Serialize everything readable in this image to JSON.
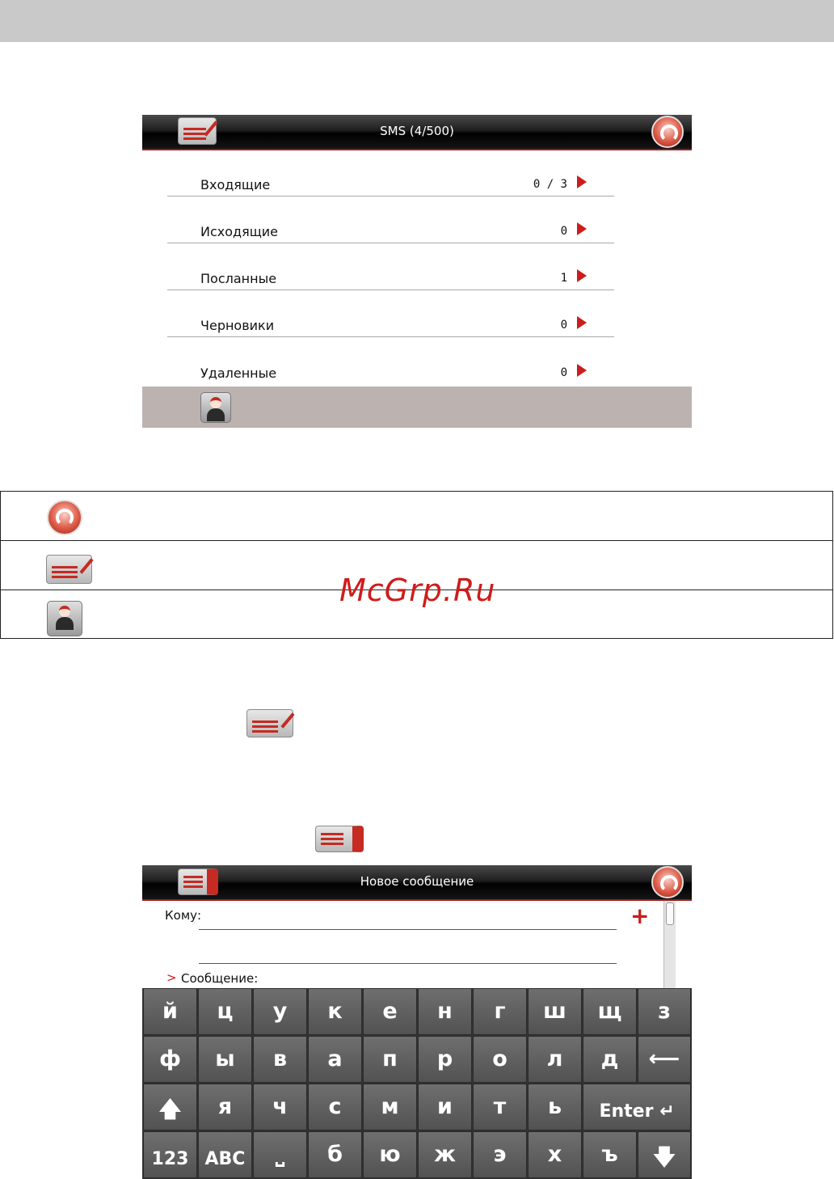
{
  "screen1": {
    "title": "SMS (4/500)",
    "folders": [
      {
        "label": "Входящие",
        "count": "0 / 3"
      },
      {
        "label": "Исходящие",
        "count": "0"
      },
      {
        "label": "Посланные",
        "count": "1"
      },
      {
        "label": "Черновики",
        "count": "0"
      },
      {
        "label": "Удаленные",
        "count": "0"
      }
    ]
  },
  "legend": {
    "icons": [
      "home-icon",
      "new-message-icon",
      "contacts-icon"
    ]
  },
  "watermark": "McGrp.Ru",
  "screen2": {
    "title": "Новое сообщение",
    "to_label": "Кому:",
    "add_symbol": "+",
    "message_label": "Сообщение:",
    "message_marker": ">",
    "keyboard": {
      "row1": [
        "й",
        "ц",
        "у",
        "к",
        "е",
        "н",
        "г",
        "ш",
        "щ",
        "з"
      ],
      "row2": [
        "ф",
        "ы",
        "в",
        "а",
        "п",
        "р",
        "о",
        "л",
        "д",
        "⟵"
      ],
      "row3": [
        "🡅",
        "я",
        "ч",
        "с",
        "м",
        "и",
        "т",
        "ь",
        "Enter ↵"
      ],
      "row4": [
        "123",
        "ABC",
        "⎵",
        "б",
        "ю",
        "ж",
        "э",
        "х",
        "ъ",
        "🡇"
      ]
    }
  }
}
